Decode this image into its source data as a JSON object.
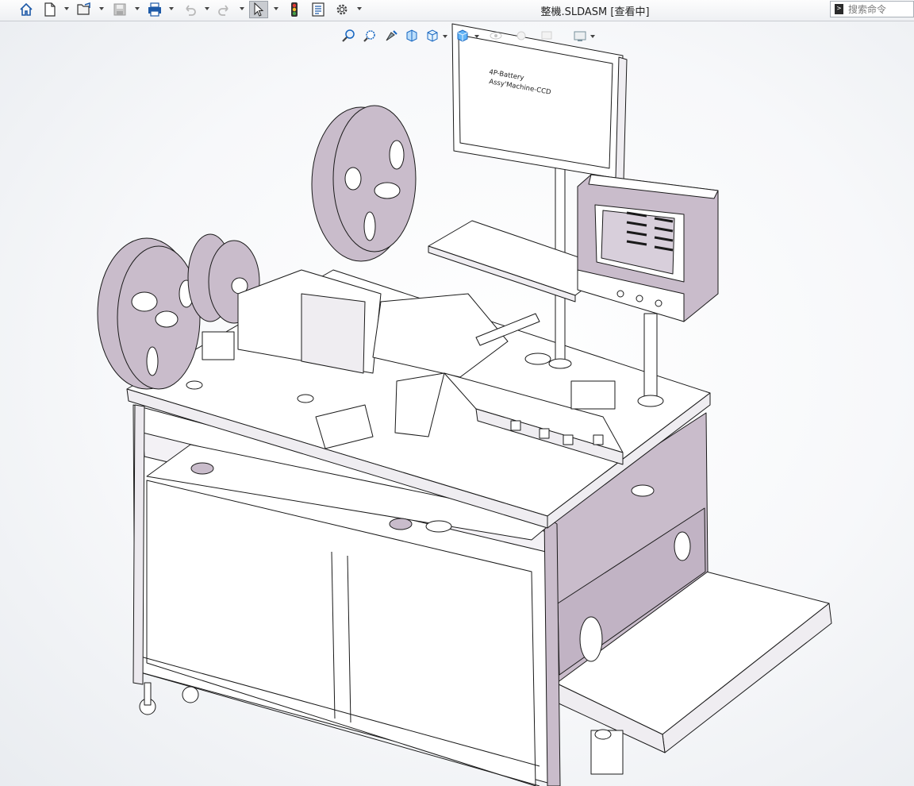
{
  "window": {
    "title": "整機.SLDASM [查看中]"
  },
  "toolbar": {
    "items": [
      "home-icon",
      "new-document-icon",
      "open-document-icon",
      "save-icon",
      "print-icon",
      "undo-icon",
      "redo-icon",
      "select-icon",
      "traffic-light-icon",
      "file-properties-icon",
      "options-gear-icon"
    ]
  },
  "search": {
    "placeholder": "搜索命令",
    "glyph": ">"
  },
  "heads_up_toolbar": {
    "items": [
      "zoom-to-fit-icon",
      "zoom-to-area-icon",
      "previous-view-icon",
      "section-view-icon",
      "view-orientation-icon",
      "display-style-icon",
      "hide-show-items-icon",
      "edit-appearance-icon",
      "apply-scene-icon",
      "view-settings-icon"
    ]
  },
  "monitor": {
    "line1": "4P-Battery",
    "line2": "Assy'Machine-CCD"
  },
  "colors": {
    "body_fill": "#c9bccb",
    "panel_fill": "#ffffff",
    "lines": "#1a1a1a",
    "accent": "#1565c0"
  }
}
